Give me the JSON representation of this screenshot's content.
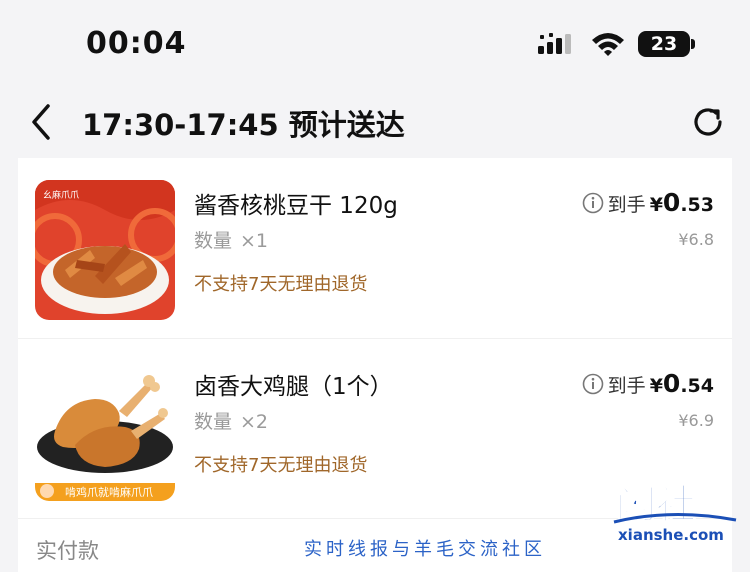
{
  "status_bar": {
    "time": "00:04",
    "battery": "23",
    "icons": [
      "cellular-signal-icon",
      "wifi-icon",
      "battery-icon"
    ]
  },
  "nav": {
    "title": "17:30-17:45 预计送达",
    "back_icon": "chevron-left-icon",
    "refresh_icon": "refresh-icon"
  },
  "items": [
    {
      "name": "酱香核桃豆干 120g",
      "qty_label": "数量",
      "qty": "×1",
      "policy": "不支持7天无理由退货",
      "price_prefix": "到手",
      "yen": "¥",
      "price_int": "0",
      "price_dec": ".53",
      "orig_price": "¥6.8",
      "thumb_brand": "幺麻爪爪"
    },
    {
      "name": "卤香大鸡腿（1个）",
      "qty_label": "数量",
      "qty": "×2",
      "policy": "不支持7天无理由退货",
      "price_prefix": "到手",
      "yen": "¥",
      "price_int": "0",
      "price_dec": ".54",
      "orig_price": "¥6.9",
      "thumb_banner": "啃鸡爪就啃麻爪爪"
    }
  ],
  "payment": {
    "label": "实付款"
  },
  "watermark": {
    "text": "实时线报与羊毛交流社区",
    "logo": "闲社",
    "site": "xianshe.com"
  },
  "colors": {
    "policy": "#a0672a",
    "watermark_blue": "#2c63c7",
    "background": "#f4f4f6"
  }
}
